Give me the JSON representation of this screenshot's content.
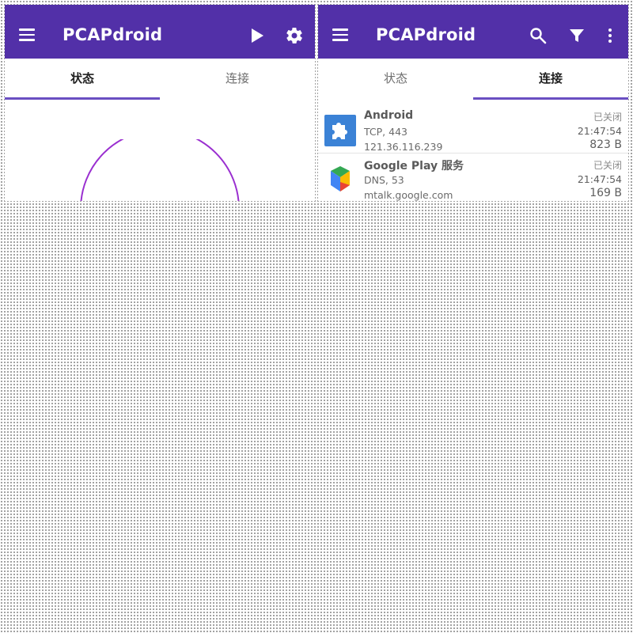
{
  "app_title": "PCAPdroid",
  "tabs": {
    "status": "状态",
    "connections": "连接"
  },
  "colors": {
    "appbar": "#5230a8",
    "indicator": "#6a4fc2",
    "gauge": "#9a2fd0"
  },
  "left_actions": [
    "play-icon",
    "gear-icon"
  ],
  "right_actions": [
    "search-icon",
    "filter-icon",
    "more-vert-icon"
  ],
  "connections": [
    {
      "app": "Android",
      "proto": "TCP, 443",
      "host": "121.36.116.239",
      "status": "已关闭",
      "time": "21:47:54",
      "size": "823 B",
      "icon": "puzzle-icon"
    },
    {
      "app": "Google Play 服务",
      "proto": "DNS, 53",
      "host": "mtalk.google.com",
      "status": "已关闭",
      "time": "21:47:54",
      "size": "169 B",
      "icon": "play-services-icon"
    }
  ]
}
